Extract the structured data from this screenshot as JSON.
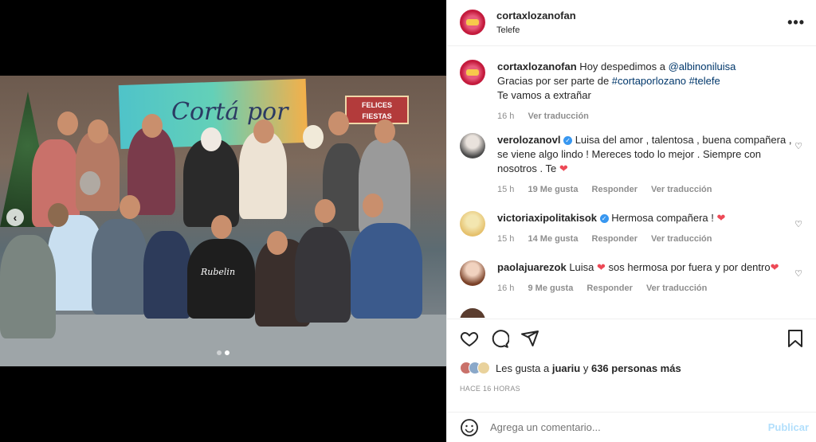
{
  "post": {
    "username": "cortaxlozanofan",
    "location": "Telefe",
    "carousel_active_index": 1,
    "carousel_count": 2
  },
  "photo": {
    "banner_text": "Cortá por",
    "sign_line1": "FELICES",
    "sign_line2": "FIESTAS",
    "shirt_text": "Rubelin"
  },
  "caption": {
    "username": "cortaxlozanofan",
    "text1": " Hoy despedimos a ",
    "mention": "@albinoniluisa",
    "line2_prefix": "Gracias por ser parte de ",
    "hashtag1": "#cortaporlozano",
    "hashtag2": "#telefe",
    "line3": "Te vamos a extrañar",
    "time": "16 h",
    "translate": "Ver traducción"
  },
  "comments": [
    {
      "username": "verolozanovl",
      "text": " Luisa del amor , talentosa , buena compañera , se viene algo lindo ! Mereces todo lo mejor . Siempre con nosotros . Te ",
      "emoji": "❤",
      "time": "15 h",
      "likes": "19 Me gusta",
      "reply": "Responder",
      "translate": "Ver traducción"
    },
    {
      "username": "victoriaxipolitakisok",
      "text": " Hermosa compañera ! ",
      "emoji": "❤",
      "time": "15 h",
      "likes": "14 Me gusta",
      "reply": "Responder",
      "translate": "Ver traducción"
    },
    {
      "username": "paolajuarezok",
      "text": " Luisa ",
      "text2": " sos hermosa por fuera y por dentro",
      "emoji": "❤",
      "time": "16 h",
      "likes": "9 Me gusta",
      "reply": "Responder",
      "translate": "Ver traducción"
    }
  ],
  "likes": {
    "prefix": "Les gusta a ",
    "user": "juariu",
    "middle": " y ",
    "count": "636 personas más"
  },
  "ago": "HACE 16 HORAS",
  "add_comment": {
    "placeholder": "Agrega un comentario...",
    "publish": "Publicar"
  },
  "colors": {
    "accent_red": "#ed4956",
    "link": "#00376b",
    "publish_disabled": "#b2dffc",
    "muted": "#8e8e8e"
  }
}
